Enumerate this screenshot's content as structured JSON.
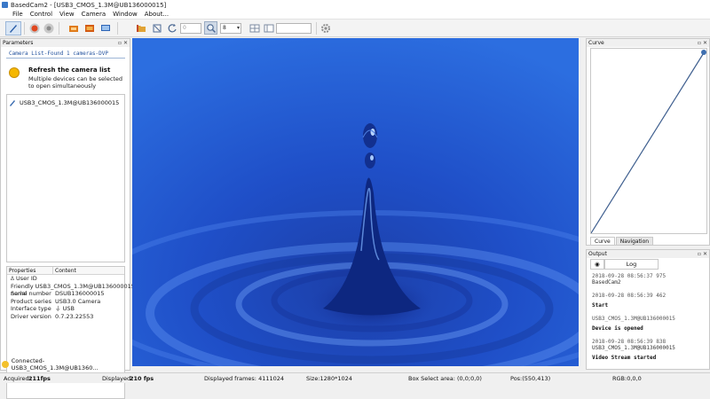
{
  "window": {
    "title": "BasedCam2 - [USB3_CMOS_1.3M@UB136000015]"
  },
  "menu": [
    "File",
    "Control",
    "View",
    "Camera",
    "Window",
    "About..."
  ],
  "toolbar": {
    "spin_value": "0",
    "combo_value": "8",
    "icons": [
      "pen-icon",
      "record-icon",
      "stop-icon",
      "snapshot-icon",
      "video-icon",
      "monitor-icon",
      "folder-icon",
      "rotate-icon",
      "refresh-icon",
      "zoom-icon",
      "grid-icon",
      "layout-icon",
      "settings-icon"
    ]
  },
  "parameters": {
    "title": "Parameters",
    "camera_list_title": "Camera List-Found 1 cameras-DVP",
    "refresh_title": "Refresh the camera list",
    "refresh_desc": "Multiple devices can be selected to open simultaneously",
    "devices": [
      "USB3_CMOS_1.3M@UB136000015"
    ]
  },
  "properties": {
    "headers": [
      "Properties",
      "Content"
    ],
    "rows": [
      {
        "k": "User ID",
        "v": ""
      },
      {
        "k": "Friendly name",
        "v": "USB3_CMOS_1.3M@UB136000015"
      },
      {
        "k": "Serial number",
        "v": "DSUB136000015"
      },
      {
        "k": "Product series",
        "v": "USB3.0 Camera"
      },
      {
        "k": "Interface type",
        "v": "USB"
      },
      {
        "k": "Driver version",
        "v": "0.7.23.22553"
      }
    ]
  },
  "connection": "Connected-USB3_CMOS_1.3M@UB1360...",
  "curve": {
    "title": "Curve",
    "tabs": [
      "Curve",
      "Navigation"
    ]
  },
  "output": {
    "title": "Output",
    "tab": "Log",
    "log": [
      {
        "ts": "2018-09-28 08:56:37 975",
        "msg": "BasedCam2"
      },
      {
        "ts": "2018-09-28 08:56:39 462",
        "msg": "Start"
      },
      {
        "ts": "USB3_CMOS_1.3M@UB136000015",
        "msg": "Device is opened"
      },
      {
        "ts": "2018-09-28 08:56:39 838",
        "msg": "USB3_CMOS_1.3M@UB136000015"
      },
      {
        "ts": "",
        "msg": "Video Stream started"
      }
    ]
  },
  "status": {
    "acquired_label": "Acquired:",
    "acquired_value": "211fps",
    "displayed_label": "Displayed:",
    "displayed_value": "210 fps",
    "frames": "Displayed frames: 4111024",
    "size": "Size:1280*1024",
    "box": "Box Select area: (0,0;0,0)",
    "pos": "Pos:(550,413)",
    "rgb": "RGB:0,0,0"
  }
}
